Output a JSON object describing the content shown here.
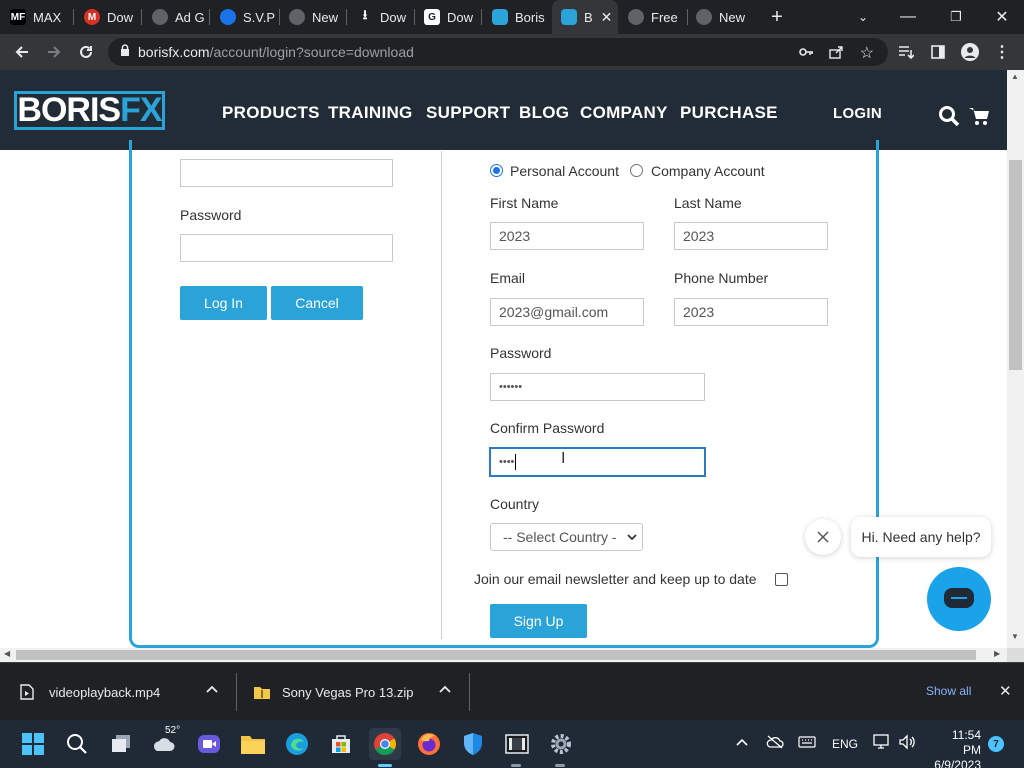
{
  "browser": {
    "tabs": [
      {
        "title": "MAX",
        "favicon_color": "#000000",
        "favicon_text": "MF"
      },
      {
        "title": "Dow",
        "favicon_color": "#d93025",
        "favicon_text": "M"
      },
      {
        "title": "Ad G",
        "favicon_color": "#5f6368",
        "favicon_text": ""
      },
      {
        "title": "S.V.P",
        "favicon_color": "#1a73e8",
        "favicon_text": ""
      },
      {
        "title": "New",
        "favicon_color": "#5f6368",
        "favicon_text": ""
      },
      {
        "title": "Dow",
        "favicon_color": "#5f6368",
        "favicon_text": ""
      },
      {
        "title": "Dow",
        "favicon_color": "#5f6368",
        "favicon_text": "G"
      },
      {
        "title": "Boris",
        "favicon_color": "#2aa3d8",
        "favicon_text": ""
      },
      {
        "title": "B",
        "favicon_color": "#2aa3d8",
        "favicon_text": ""
      },
      {
        "title": "Free",
        "favicon_color": "#5f6368",
        "favicon_text": ""
      },
      {
        "title": "New",
        "favicon_color": "#5f6368",
        "favicon_text": ""
      }
    ],
    "url_host": "borisfx.com",
    "url_path": "/account/login?source=download"
  },
  "site": {
    "logo_main": "BORIS",
    "logo_fx": "FX",
    "nav": [
      "PRODUCTS",
      "TRAINING",
      "SUPPORT",
      "BLOG",
      "COMPANY",
      "PURCHASE"
    ],
    "login": "LOGIN"
  },
  "login_form": {
    "password_label": "Password",
    "login_button": "Log In",
    "cancel_button": "Cancel"
  },
  "signup_form": {
    "account_personal": "Personal Account",
    "account_company": "Company Account",
    "first_name_label": "First Name",
    "first_name_value": "2023",
    "last_name_label": "Last Name",
    "last_name_value": "2023",
    "email_label": "Email",
    "email_value": "2023@gmail.com",
    "phone_label": "Phone Number",
    "phone_value": "2023",
    "password_label": "Password",
    "password_value": "••••••",
    "confirm_label": "Confirm Password",
    "confirm_value": "••••",
    "country_label": "Country",
    "country_value": "-- Select Country -",
    "newsletter_label": "Join our email newsletter and keep up to date",
    "signup_button": "Sign Up"
  },
  "chat": {
    "greeting": "Hi. Need any help?"
  },
  "downloads": {
    "items": [
      "videoplayback.mp4",
      "Sony Vegas Pro 13.zip"
    ],
    "show_all": "Show all"
  },
  "taskbar": {
    "weather_temp": "52°",
    "language": "ENG",
    "time": "11:54 PM",
    "date": "6/9/2023",
    "notifications": "7"
  }
}
